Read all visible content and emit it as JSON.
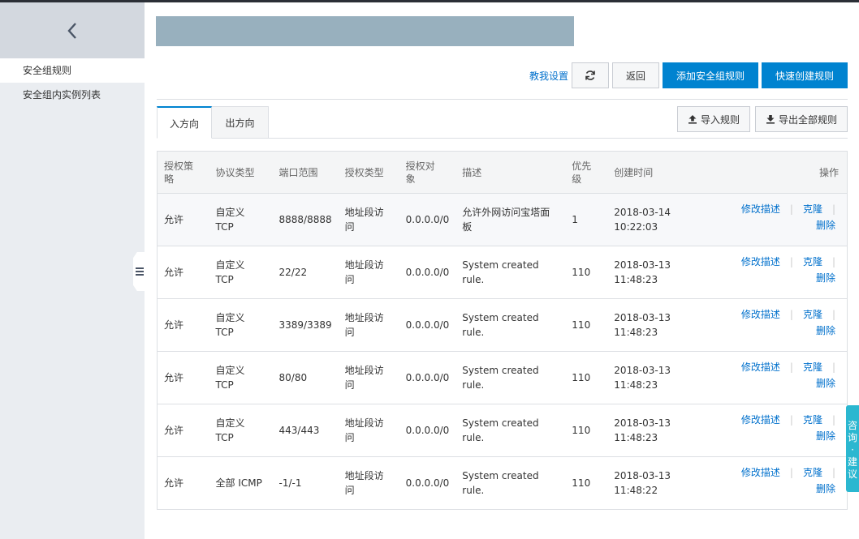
{
  "sidebar": {
    "items": [
      {
        "label": "安全组规则"
      },
      {
        "label": "安全组内实例列表"
      }
    ]
  },
  "toolbar": {
    "help_link": "教我设置",
    "back_label": "返回",
    "add_label": "添加安全组规则",
    "quick_label": "快速创建规则"
  },
  "tabs": [
    {
      "label": "入方向"
    },
    {
      "label": "出方向"
    }
  ],
  "io": {
    "import_label": "导入规则",
    "export_label": "导出全部规则"
  },
  "table": {
    "headers": {
      "policy_1": "授权策",
      "policy_2": "略",
      "protocol": "协议类型",
      "port": "端口范围",
      "auth_type": "授权类型",
      "auth_obj_1": "授权对",
      "auth_obj_2": "象",
      "desc": "描述",
      "priority_1": "优先",
      "priority_2": "级",
      "created": "创建时间",
      "ops": "操作"
    },
    "rows": [
      {
        "policy": "允许",
        "proto_1": "自定义",
        "proto_2": "TCP",
        "port": "8888/8888",
        "type_1": "地址段访",
        "type_2": "问",
        "obj": "0.0.0.0/0",
        "desc_1": "允许外网访问宝塔面",
        "desc_2": "板",
        "priority": "1",
        "date": "2018-03-14",
        "time": "10:22:03"
      },
      {
        "policy": "允许",
        "proto_1": "自定义",
        "proto_2": "TCP",
        "port": "22/22",
        "type_1": "地址段访",
        "type_2": "问",
        "obj": "0.0.0.0/0",
        "desc_1": "System created rule.",
        "desc_2": "",
        "priority": "110",
        "date": "2018-03-13",
        "time": "11:48:23"
      },
      {
        "policy": "允许",
        "proto_1": "自定义",
        "proto_2": "TCP",
        "port": "3389/3389",
        "type_1": "地址段访",
        "type_2": "问",
        "obj": "0.0.0.0/0",
        "desc_1": "System created rule.",
        "desc_2": "",
        "priority": "110",
        "date": "2018-03-13",
        "time": "11:48:23"
      },
      {
        "policy": "允许",
        "proto_1": "自定义",
        "proto_2": "TCP",
        "port": "80/80",
        "type_1": "地址段访",
        "type_2": "问",
        "obj": "0.0.0.0/0",
        "desc_1": "System created rule.",
        "desc_2": "",
        "priority": "110",
        "date": "2018-03-13",
        "time": "11:48:23"
      },
      {
        "policy": "允许",
        "proto_1": "自定义",
        "proto_2": "TCP",
        "port": "443/443",
        "type_1": "地址段访",
        "type_2": "问",
        "obj": "0.0.0.0/0",
        "desc_1": "System created rule.",
        "desc_2": "",
        "priority": "110",
        "date": "2018-03-13",
        "time": "11:48:23"
      },
      {
        "policy": "允许",
        "proto_1": "全部 ICMP",
        "proto_2": "",
        "port": "-1/-1",
        "type_1": "地址段访",
        "type_2": "问",
        "obj": "0.0.0.0/0",
        "desc_1": "System created rule.",
        "desc_2": "",
        "priority": "110",
        "date": "2018-03-13",
        "time": "11:48:22"
      }
    ],
    "actions": {
      "edit": "修改描述",
      "clone": "克隆",
      "delete": "删除"
    }
  },
  "consult_label": "咨询·建议",
  "icons": [
    "chevron-left-icon",
    "menu-collapse-icon",
    "refresh-icon",
    "upload-icon",
    "download-icon"
  ],
  "colors": {
    "primary": "#0083d0",
    "link": "#0070cc",
    "consult": "#2bb7d0",
    "title_bar": "#98b0be"
  }
}
